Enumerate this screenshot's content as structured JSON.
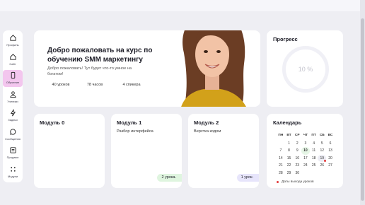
{
  "sidebar": {
    "items": [
      {
        "label": "Профиль",
        "icon": "home-icon"
      },
      {
        "label": "Сайт",
        "icon": "home-outline-icon"
      },
      {
        "label": "Обучение",
        "icon": "mobile-icon",
        "active": true
      },
      {
        "label": "Ученики",
        "icon": "user-icon"
      },
      {
        "label": "Задачи",
        "icon": "lightning-icon"
      },
      {
        "label": "Сообщения",
        "icon": "chat-icon"
      },
      {
        "label": "Продажи",
        "icon": "sales-icon"
      },
      {
        "label": "Модули",
        "icon": "grid-icon"
      }
    ]
  },
  "hero": {
    "title": "Добро пожаловать на курс по обучению SMM маркетингу",
    "subtitle": "Добро пожаловать! Тут будет что-то умное на богатом!",
    "pills": [
      {
        "text": "40 уроков",
        "color": "#f6d8f2"
      },
      {
        "text": "78 часов",
        "color": "#dff5df"
      },
      {
        "text": "4 спикера",
        "color": "#e7e5fb"
      }
    ]
  },
  "progress": {
    "title": "Прогресс",
    "value_label": "10 %",
    "value": 0.1
  },
  "modules": [
    {
      "title": "Модуль 0",
      "subtitle": "",
      "lessons": ""
    },
    {
      "title": "Модуль 1",
      "subtitle": "Разбор интерфейса",
      "lessons": "2 урока.",
      "color": "#dff5df"
    },
    {
      "title": "Модуль 2",
      "subtitle": "Верстка кодом",
      "lessons": "1 урок.",
      "color": "#e7e5fb"
    }
  ],
  "calendar": {
    "title": "Календарь",
    "weekdays": [
      "ПН",
      "ВТ",
      "СР",
      "ЧТ",
      "ПТ",
      "СБ",
      "ВС"
    ],
    "weeks": [
      [
        "",
        "1",
        "2",
        "3",
        "4",
        "5",
        "6"
      ],
      [
        "7",
        "8",
        "9",
        "10",
        "11",
        "12",
        "13"
      ],
      [
        "14",
        "15",
        "16",
        "17",
        "18",
        "19",
        "20"
      ],
      [
        "21",
        "22",
        "23",
        "24",
        "25",
        "26",
        "27"
      ],
      [
        "28",
        "29",
        "30",
        "",
        "",
        "",
        ""
      ]
    ],
    "today": "10",
    "marked": "19",
    "legend": "Даты выхода уроков",
    "accent_color": "#e23a3a"
  }
}
